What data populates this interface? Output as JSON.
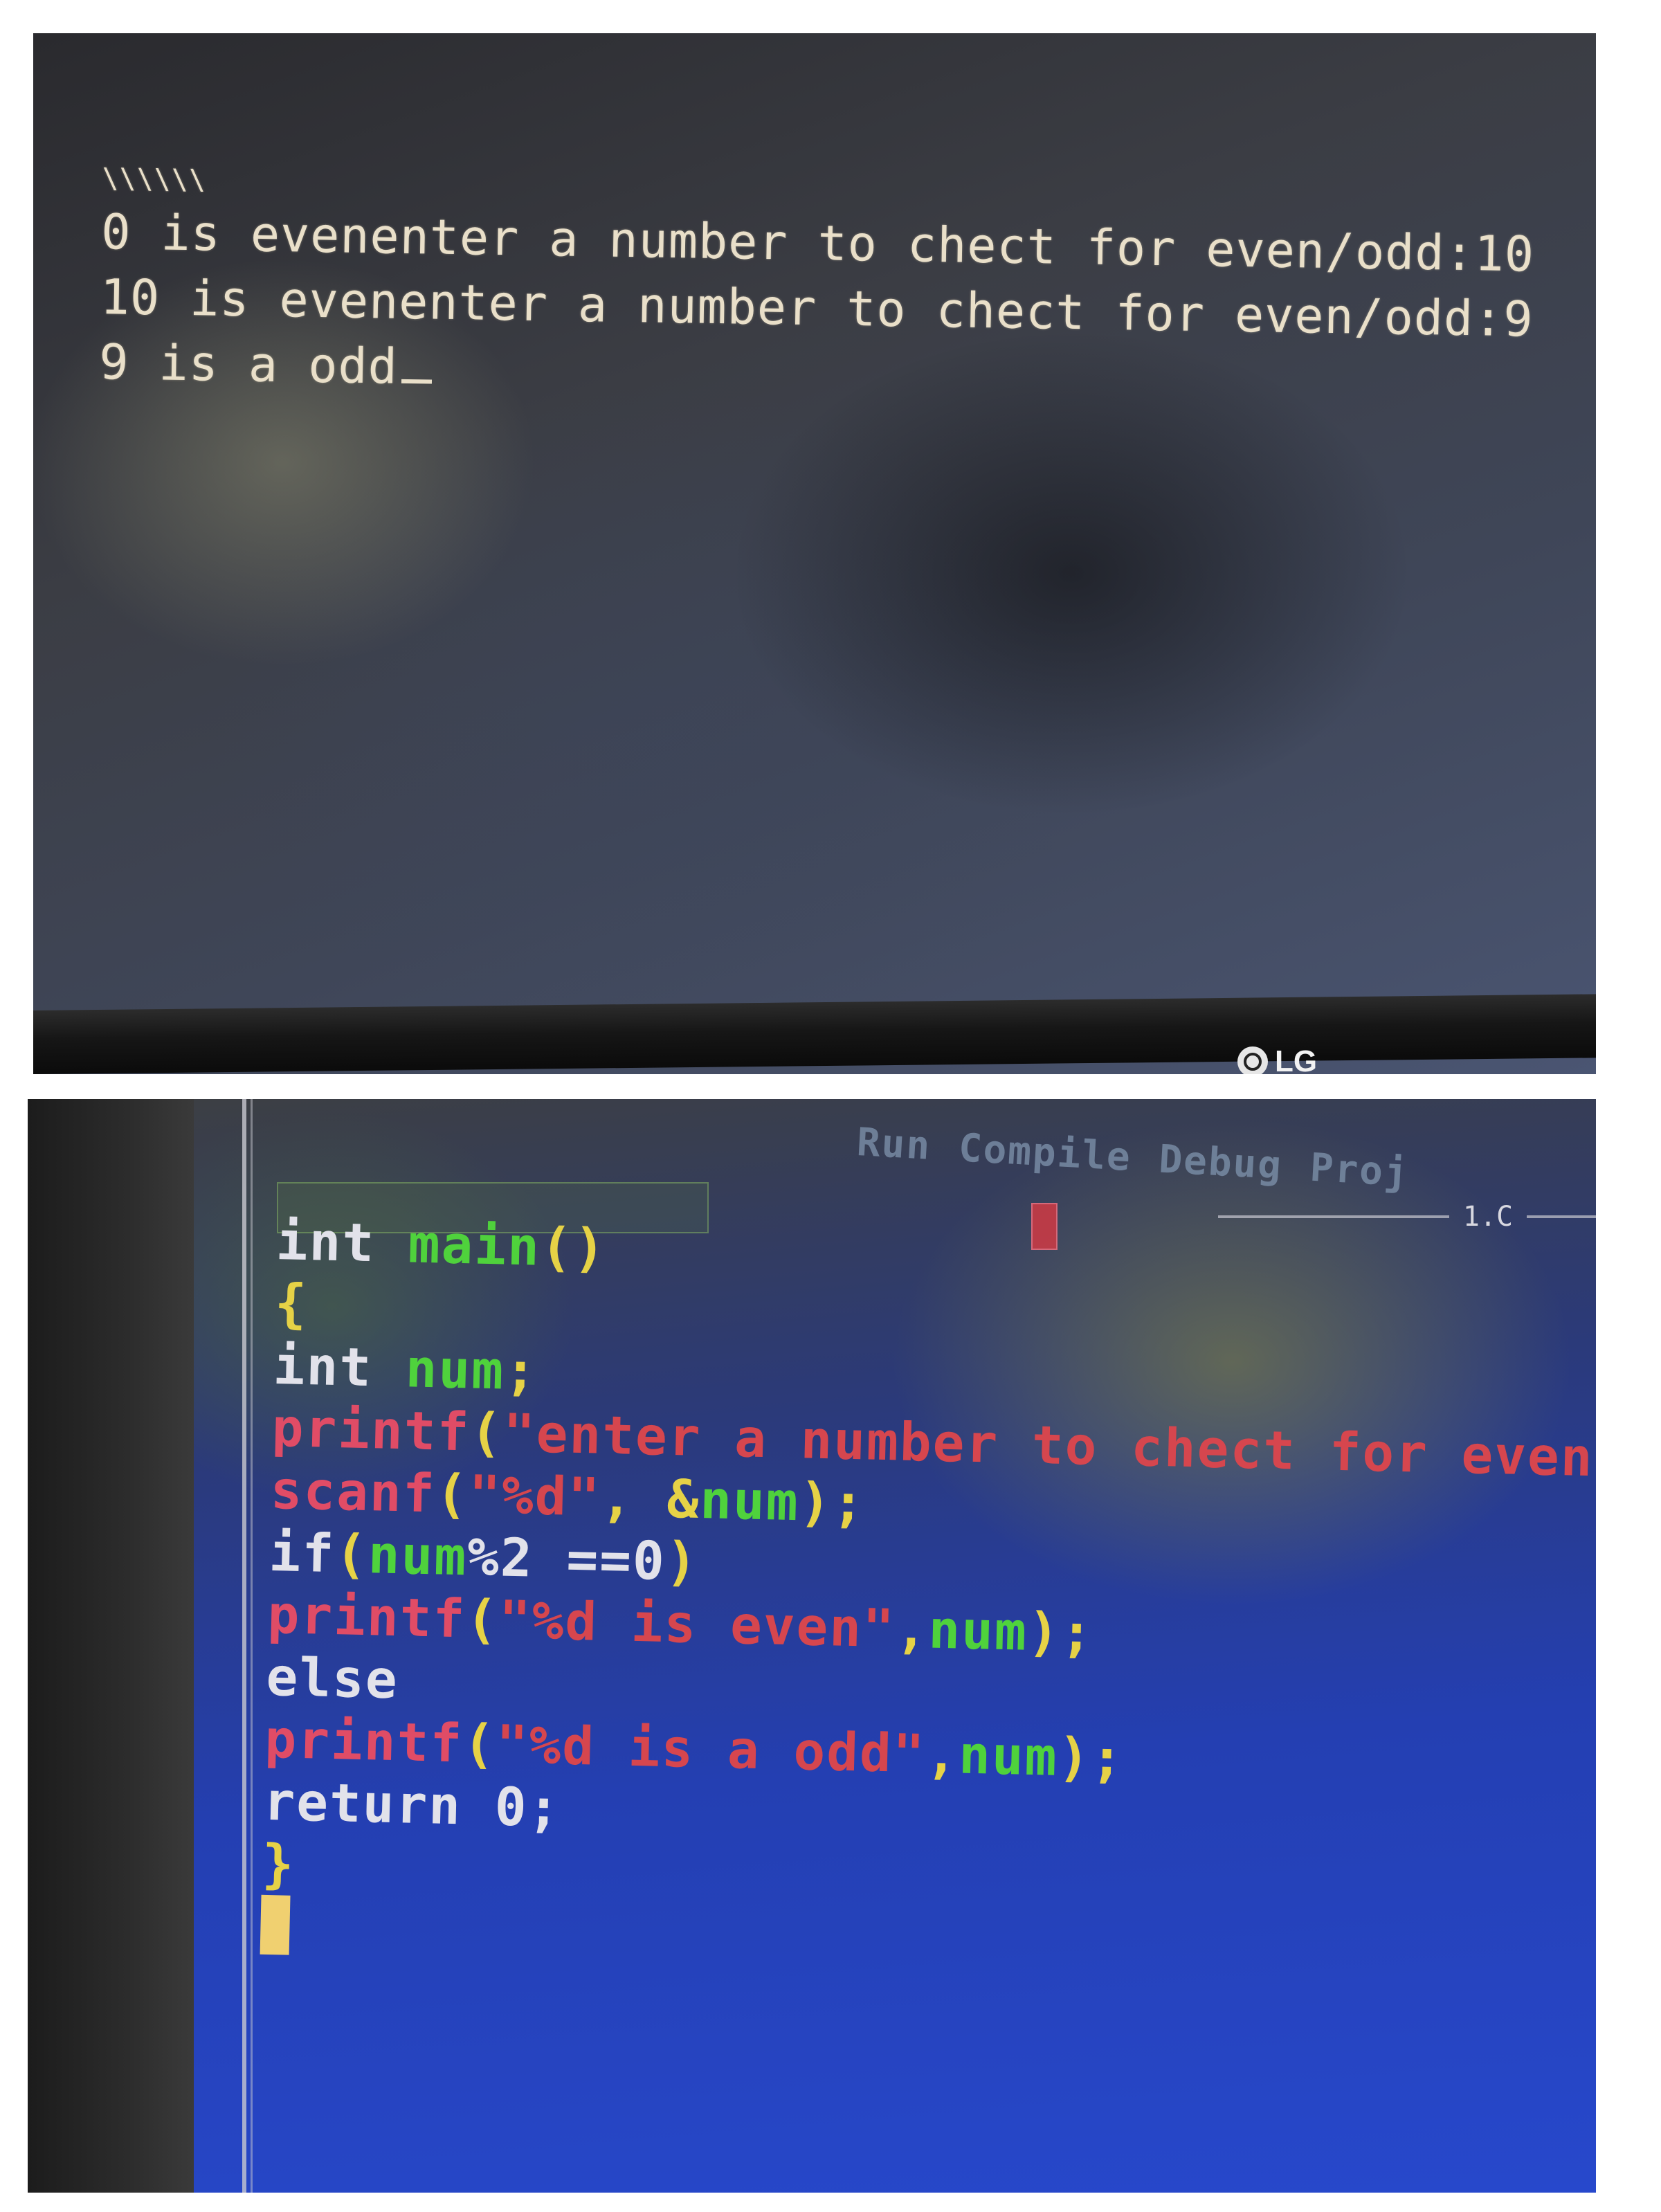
{
  "console": {
    "top_marks": "\\\\\\\\\\\\",
    "line1": "0 is evenenter a number to chect for even/odd:10",
    "line2": "10 is evenenter a number to chect for even/odd:9",
    "line3": "9 is a odd"
  },
  "monitor": {
    "brand": "LG"
  },
  "editor": {
    "menu": [
      "Run",
      "Compile",
      "Debug",
      "Proj"
    ],
    "file_name": "1.C",
    "code": {
      "l1_int": "int",
      "l1_main": "main",
      "l1_parens": "()",
      "l2_brace": "{",
      "l3_int": "int",
      "l3_num": "num",
      "l3_semi": ";",
      "l4_printf": "printf",
      "l4_open": "(",
      "l4_str": "\"enter a number to chect for even/odd:\"",
      "l4_close": ");",
      "l5_scanf": "scanf",
      "l5_open": "(",
      "l5_str": "\"%d\"",
      "l5_comma": ", ",
      "l5_amp": "&",
      "l5_num": "num",
      "l5_close": ");",
      "l6_if": "if",
      "l6_open": "(",
      "l6_num": "num",
      "l6_expr": "%2 ==0",
      "l6_close": ")",
      "l7_printf": "printf",
      "l7_open": "(",
      "l7_str": "\"%d is even\"",
      "l7_comma": ",",
      "l7_num": "num",
      "l7_close": ");",
      "l8_else": "else",
      "l9_printf": "printf",
      "l9_open": "(",
      "l9_str": "\"%d is a odd\"",
      "l9_comma": ",",
      "l9_num": "num",
      "l9_close": ");",
      "l10_return": "return 0;",
      "l11_brace": "}"
    }
  },
  "colors": {
    "console_text": "#e9dfc9",
    "editor_bg": "#2748cc",
    "keyword": "#e2e2ea",
    "identifier": "#4fd23c",
    "punctuation": "#e6d246",
    "string": "#d6464e"
  }
}
